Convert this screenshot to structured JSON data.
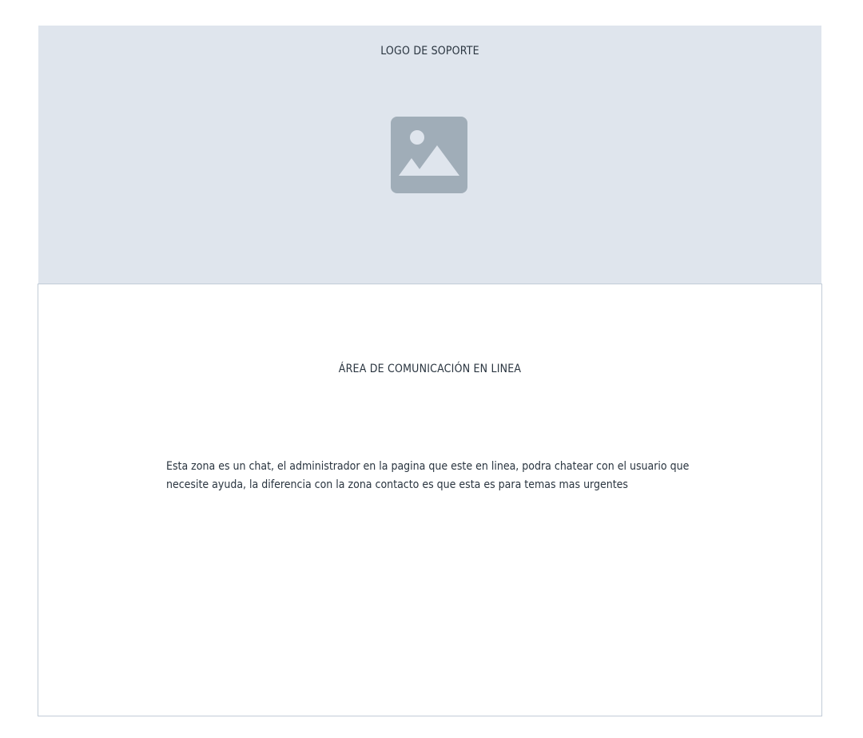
{
  "logo_panel": {
    "title": "LOGO DE SOPORTE",
    "image_icon": "image-placeholder-icon",
    "background_color": "#dfe5ed",
    "icon_color": "#a0adb8"
  },
  "chat_panel": {
    "title": "ÁREA DE COMUNICACIÓN EN LINEA",
    "description": "Esta zona es un chat, el administrador en la pagina que este en linea, podra chatear con el usuario que necesite ayuda, la diferencia con la zona contacto es que esta es para temas mas urgentes",
    "border_color": "#c2ccd7"
  }
}
